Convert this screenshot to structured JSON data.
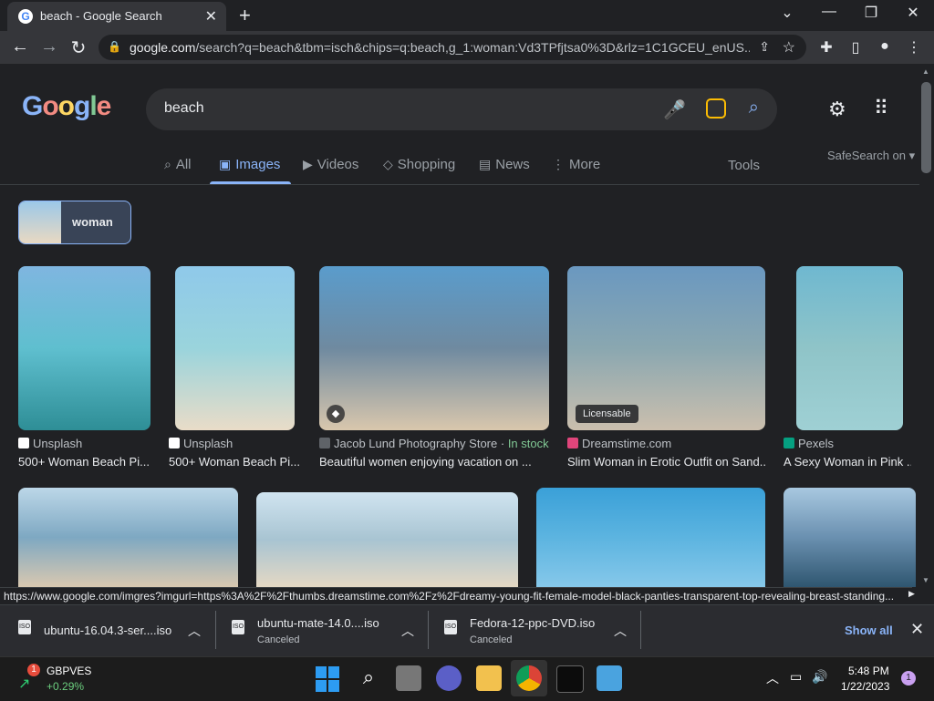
{
  "browser": {
    "tab_title": "beach - Google Search",
    "url_domain": "google.com",
    "url_path": "/search?q=beach&tbm=isch&chips=q:beach,g_1:woman:Vd3TPfjtsa0%3D&rlz=1C1GCEU_enUS...",
    "status_url": "https://www.google.com/imgres?imgurl=https%3A%2F%2Fthumbs.dreamstime.com%2Fz%2Fdreamy-young-fit-female-model-black-panties-transparent-top-revealing-breast-standing..."
  },
  "google": {
    "logo_letters": [
      "G",
      "o",
      "o",
      "g",
      "l",
      "e"
    ],
    "query": "beach",
    "tabs": [
      {
        "label": "All",
        "icon": "search-icon"
      },
      {
        "label": "Images",
        "icon": "image-icon"
      },
      {
        "label": "Videos",
        "icon": "video-icon"
      },
      {
        "label": "Shopping",
        "icon": "tag-icon"
      },
      {
        "label": "News",
        "icon": "news-icon"
      },
      {
        "label": "More",
        "icon": "more-icon"
      }
    ],
    "tools_label": "Tools",
    "safesearch_label": "SafeSearch on",
    "chip_label": "woman"
  },
  "results": [
    {
      "source": "Unsplash",
      "caption": "500+ Woman Beach Pi...",
      "colors": [
        "#7fb6e0",
        "#5fbfcf",
        "#2e8e96"
      ]
    },
    {
      "source": "Unsplash",
      "caption": "500+ Woman Beach Pi...",
      "colors": [
        "#8fc9ea",
        "#9ad4dc",
        "#e9dcc8"
      ]
    },
    {
      "source": "Jacob Lund Photography Store",
      "stock": "In stock",
      "caption": "Beautiful women enjoying vacation on ...",
      "colors": [
        "#5a9ccc",
        "#6f8aa0",
        "#d9c7ad"
      ]
    },
    {
      "source": "Dreamstime.com",
      "caption": "Slim Woman in Erotic Outfit on Sand...",
      "badge": "Licensable",
      "colors": [
        "#6a98c0",
        "#8aa7b0",
        "#cbbfae"
      ]
    },
    {
      "source": "Pexels",
      "caption": "A Sexy Woman in Pink ...",
      "colors": [
        "#6fb8d0",
        "#8fc4c8",
        "#9fd0d4"
      ]
    }
  ],
  "row2_colors": [
    [
      "#bcd7e8",
      "#7ea8c2",
      "#d9c8b0"
    ],
    [
      "#d0e4f0",
      "#a8c4d2",
      "#e4d8c4"
    ],
    [
      "#3aa0d8",
      "#5cb4e0",
      "#86c8ea"
    ],
    [
      "#a8c8e0",
      "#6a90b0",
      "#2f5670"
    ]
  ],
  "downloads": [
    {
      "name": "ubuntu-16.04.3-ser....iso",
      "status": ""
    },
    {
      "name": "ubuntu-mate-14.0....iso",
      "status": "Canceled"
    },
    {
      "name": "Fedora-12-ppc-DVD.iso",
      "status": "Canceled"
    }
  ],
  "download_file_label": "ISO",
  "show_all_label": "Show all",
  "taskbar": {
    "stock_name": "GBPVES",
    "stock_change": "+0.29%",
    "stock_badge": "1",
    "time": "5:48 PM",
    "date": "1/22/2023",
    "notif_count": "1"
  }
}
